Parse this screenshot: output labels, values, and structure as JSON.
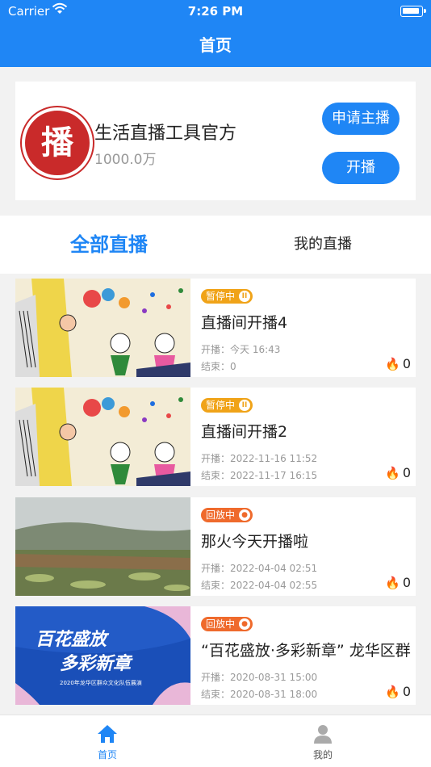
{
  "status": {
    "carrier": "Carrier",
    "time": "7:26 PM"
  },
  "nav": {
    "title": "首页"
  },
  "profile": {
    "avatar_char": "播",
    "name": "生活直播工具官方",
    "count": "1000.0万",
    "apply_label": "申请主播",
    "start_label": "开播"
  },
  "tabs": {
    "all": "全部直播",
    "mine": "我的直播"
  },
  "streams": [
    {
      "badge": "暂停中",
      "badge_type": "paused",
      "title": "直播间开播4",
      "start": "开播：今天 16:43",
      "end": "结束：0",
      "heat": "0",
      "thumb": "drawing"
    },
    {
      "badge": "暂停中",
      "badge_type": "paused",
      "title": "直播间开播2",
      "start": "开播：2022-11-16 11:52",
      "end": "结束：2022-11-17 16:15",
      "heat": "0",
      "thumb": "drawing"
    },
    {
      "badge": "回放中",
      "badge_type": "replay",
      "title": "那火今天开播啦",
      "start": "开播：2022-04-04 02:51",
      "end": "结束：2022-04-04 02:55",
      "heat": "0",
      "thumb": "field"
    },
    {
      "badge": "回放中",
      "badge_type": "replay",
      "title": "“百花盛放·多彩新章” 龙华区群",
      "start": "开播：2020-08-31 15:00",
      "end": "结束：2020-08-31 18:00",
      "heat": "0",
      "thumb": "poster"
    }
  ],
  "poster": {
    "line1": "百花盛放",
    "line2": "多彩新章",
    "line3": "2020年龙华区群众文化队伍展演"
  },
  "tabbar": {
    "home": "首页",
    "mine": "我的"
  },
  "colors": {
    "primary": "#1f86f5",
    "paused": "#f0a318",
    "replay": "#ef6a2c",
    "avatar": "#c92a2a"
  }
}
